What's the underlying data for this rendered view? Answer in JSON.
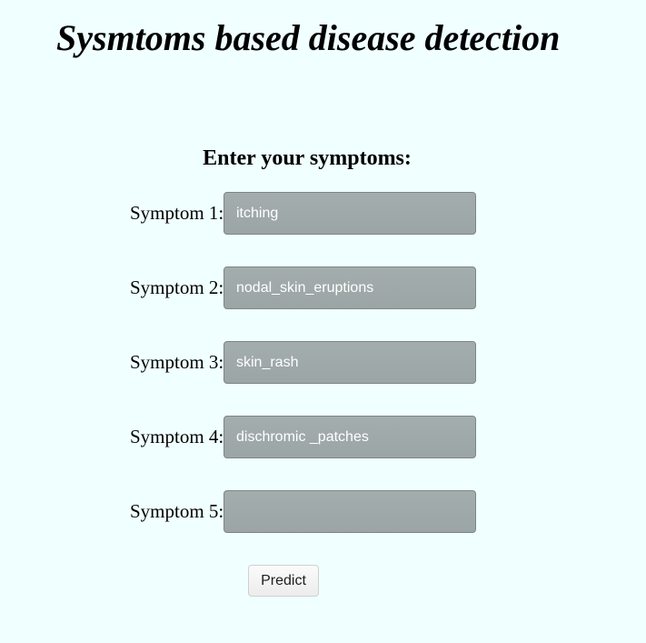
{
  "page": {
    "title": "Sysmtoms based disease detection"
  },
  "form": {
    "heading": "Enter your symptoms:",
    "symptoms": [
      {
        "label": "Symptom 1:",
        "value": "itching"
      },
      {
        "label": "Symptom 2:",
        "value": "nodal_skin_eruptions"
      },
      {
        "label": "Symptom 3:",
        "value": "skin_rash"
      },
      {
        "label": "Symptom 4:",
        "value": "dischromic _patches"
      },
      {
        "label": "Symptom 5:",
        "value": ""
      }
    ],
    "submit_label": "Predict"
  },
  "colors": {
    "background": "#f0ffff",
    "input_fill": "#a0a9a9",
    "input_text": "#ffffff"
  }
}
